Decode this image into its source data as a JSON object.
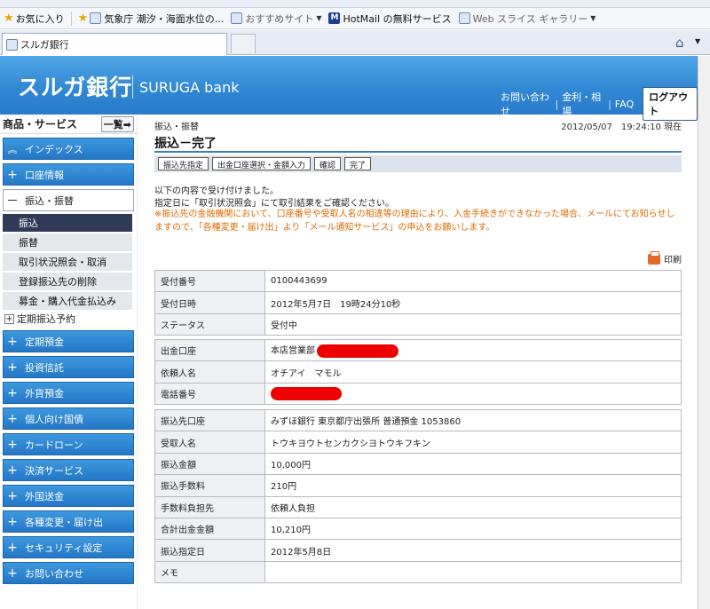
{
  "browser": {
    "favorites_label": "お気に入り",
    "fav_items": [
      {
        "label": "気象庁 潮汐・海面水位の...",
        "icon": "ie-page-icon"
      },
      {
        "label": "おすすめサイト",
        "icon": "ie-page-icon"
      },
      {
        "label": "HotMail の無料サービス",
        "icon": "msn-icon"
      },
      {
        "label": "Web スライス ギャラリー",
        "icon": "ie-page-icon"
      }
    ],
    "tab_title": "スルガ銀行"
  },
  "header": {
    "logo_jp": "スルガ銀行",
    "logo_en": "SURUGA bank",
    "links": [
      "お問い合わせ",
      "金利・相場",
      "FAQ"
    ],
    "logout_label": "ログアウト"
  },
  "sidebar": {
    "title": "商品・サービス",
    "list_button": "一覧",
    "items": [
      {
        "label": "インデックス",
        "mark": "«"
      },
      {
        "label": "口座情報",
        "mark": "+"
      },
      {
        "label": "振込・振替",
        "mark": "－"
      },
      {
        "label": "定期預金",
        "mark": "+"
      },
      {
        "label": "投資信託",
        "mark": "+"
      },
      {
        "label": "外貨預金",
        "mark": "+"
      },
      {
        "label": "個人向け国債",
        "mark": "+"
      },
      {
        "label": "カードローン",
        "mark": "+"
      },
      {
        "label": "決済サービス",
        "mark": "+"
      },
      {
        "label": "外国送金",
        "mark": "+"
      },
      {
        "label": "各種変更・届け出",
        "mark": "+"
      },
      {
        "label": "セキュリティ設定",
        "mark": "+"
      },
      {
        "label": "お問い合わせ",
        "mark": "+"
      }
    ],
    "subitems": [
      "振込",
      "振替",
      "取引状況照会・取消",
      "登録振込先の削除",
      "募金・購入代金払込み"
    ],
    "sub_teiki": "定期振込予約"
  },
  "main": {
    "breadcrumb": "振込・振替",
    "datetime": "2012/05/07　19:24:10 現在",
    "title": "振込－完了",
    "steps": [
      "振込先指定",
      "出金口座選択・金額入力",
      "確認",
      "完了"
    ],
    "msg1": "以下の内容で受け付けました。",
    "msg2": "指定日に「取引状況照会」にて取引結果をご確認ください。",
    "warning": "※振込先の金融機関において、口座番号や受取人名の相違等の理由により、入金手続きができなかった場合、メールにてお知らせしますので、「各種変更・届け出」より「メール通知サービス」の申込をお願いします。",
    "print_label": "印刷",
    "table1": [
      {
        "k": "受付番号",
        "v": "0100443699"
      },
      {
        "k": "受付日時",
        "v": "2012年5月7日　19時24分10秒"
      },
      {
        "k": "ステータス",
        "v": "受付中"
      }
    ],
    "table2": [
      {
        "k": "出金口座",
        "v": "本店営業部"
      },
      {
        "k": "依頼人名",
        "v": "オチアイ　マモル"
      },
      {
        "k": "電話番号",
        "v": ""
      }
    ],
    "table3": [
      {
        "k": "振込先口座",
        "v": "みずほ銀行 東京都庁出張所 普通預金 1053860"
      },
      {
        "k": "受取人名",
        "v": "トウキヨウトセンカクシヨトウキフキン"
      },
      {
        "k": "振込金額",
        "v": "10,000円"
      },
      {
        "k": "振込手数料",
        "v": "210円"
      },
      {
        "k": "手数料負担先",
        "v": "依頼人負担"
      },
      {
        "k": "合計出金金額",
        "v": "10,210円"
      },
      {
        "k": "振込指定日",
        "v": "2012年5月8日"
      },
      {
        "k": "メモ",
        "v": ""
      }
    ]
  }
}
